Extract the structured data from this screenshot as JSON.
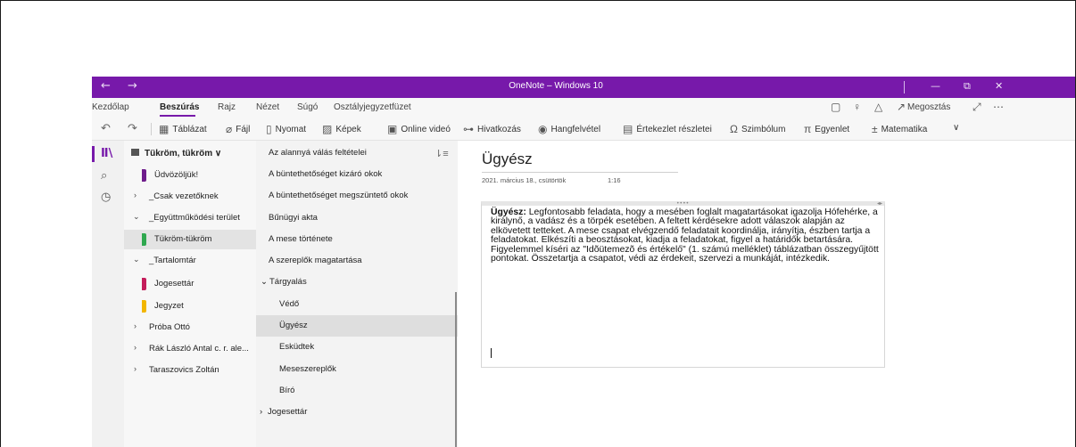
{
  "titlebar": {
    "title": "OneNote – Windows 10",
    "back": "←",
    "forward": "→",
    "minimize": "—",
    "restore": "⧉",
    "close": "✕"
  },
  "menu": {
    "tabs": [
      "Kezdőlap",
      "Beszúrás",
      "Rajz",
      "Nézet",
      "Súgó",
      "Osztályjegyzetfüzet"
    ],
    "active": "Beszúrás",
    "share": "Megosztás"
  },
  "ribbon": {
    "items": [
      {
        "icon": "table-icon",
        "glyph": "▦",
        "label": "Táblázat"
      },
      {
        "icon": "attach-icon",
        "glyph": "⌀",
        "label": "Fájl"
      },
      {
        "icon": "printout-icon",
        "glyph": "▯",
        "label": "Nyomat"
      },
      {
        "icon": "image-icon",
        "glyph": "▨",
        "label": "Képek"
      },
      {
        "icon": "online-video-icon",
        "glyph": "▣",
        "label": "Online videó"
      },
      {
        "icon": "link-icon",
        "glyph": "⊶",
        "label": "Hivatkozás"
      },
      {
        "icon": "audio-icon",
        "glyph": "◉",
        "label": "Hangfelvétel"
      },
      {
        "icon": "meeting-details-icon",
        "glyph": "▤",
        "label": "Értekezlet részletei"
      },
      {
        "icon": "symbol-icon",
        "glyph": "Ω",
        "label": "Szimbólum"
      },
      {
        "icon": "equation-icon",
        "glyph": "π",
        "label": "Egyenlet"
      },
      {
        "icon": "math-icon",
        "glyph": "±",
        "label": "Matematika"
      }
    ],
    "more": "∨"
  },
  "notebook": {
    "name": "Tükröm, tükröm",
    "sections": [
      {
        "label": "Üdvözöljük!",
        "color": "#6e1c8b",
        "kind": "section"
      },
      {
        "label": "_Csak vezetőknek",
        "kind": "group",
        "expanded": false
      },
      {
        "label": "_Együttműködési terület",
        "kind": "group",
        "expanded": true
      },
      {
        "label": "Tükröm-tükröm",
        "color": "#2fa84f",
        "kind": "section",
        "selected": true
      },
      {
        "label": "_Tartalomtár",
        "kind": "group",
        "expanded": true
      },
      {
        "label": "Jogesettár",
        "color": "#c41d5b",
        "kind": "section"
      },
      {
        "label": "Jegyzet",
        "color": "#f2b600",
        "kind": "section"
      },
      {
        "label": "Próba Ottó",
        "kind": "group",
        "expanded": false
      },
      {
        "label": "Rák László Antal c. r. ale...",
        "kind": "group",
        "expanded": false
      },
      {
        "label": "Taraszovics Zoltán",
        "kind": "group",
        "expanded": false
      }
    ]
  },
  "pages": {
    "items": [
      {
        "label": "Az alannyá válás feltételei"
      },
      {
        "label": "A büntethetőséget kizáró okok"
      },
      {
        "label": "A büntethetőséget megszüntető okok"
      },
      {
        "label": "Bűnügyi akta"
      },
      {
        "label": "A mese története"
      },
      {
        "label": "A szereplők magatartása"
      },
      {
        "label": "Tárgyalás",
        "group": true
      },
      {
        "label": "Védő",
        "sub": true
      },
      {
        "label": "Ügyész",
        "sub": true,
        "selected": true
      },
      {
        "label": "Esküdtek",
        "sub": true
      },
      {
        "label": "Meseszereplők",
        "sub": true
      },
      {
        "label": "Bíró",
        "sub": true
      },
      {
        "label": "Jogesettár",
        "group": true,
        "collapsed": true
      }
    ]
  },
  "page": {
    "title": "Ügyész",
    "date": "2021. március 18., csütörtök",
    "time": "1:16",
    "note_bold": "Ügyész:",
    "note_text": " Legfontosabb feladata, hogy a mesében foglalt magatartásokat igazolja Hófehérke, a királynő, a vadász és a törpék esetében. A feltett kérdésekre adott válaszok alapján az elkövetett tetteket. A mese csapat elvégzendő feladatait koordinálja, irányítja, észben tartja a feladatokat. Elkészíti a beosztásokat, kiadja a feladatokat, figyel a határidők betartására. Figyelemmel kíséri az \"Idõütemezõ és értékelő\" (1. számú melléklet) táblázatban összegyűjtött pontokat. Összetartja a csapatot, védi az érdekeit, szervezi a munkáját, intézkedik."
  },
  "colors": {
    "accent": "#7719aa"
  }
}
